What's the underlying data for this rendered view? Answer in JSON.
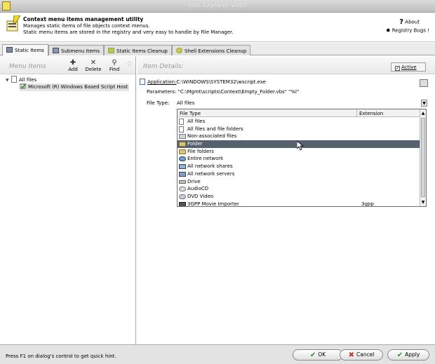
{
  "window": {
    "title": "Fast Explorer 2007"
  },
  "header": {
    "title": "Context menu items management utility",
    "line1": "Manages static items of file objects context menus.",
    "line2": "Static menu items are stored in the registry and very easy to handle by File Manager.",
    "about_label": "About",
    "registry_bugs_label": "Registry Bugs !"
  },
  "tabs": [
    {
      "label": "Static Items",
      "icon": "static-items-icon",
      "active": true
    },
    {
      "label": "Submenu Items",
      "icon": "submenu-icon",
      "active": false
    },
    {
      "label": "Static Items Cleanup",
      "icon": "cleanup-icon",
      "active": false
    },
    {
      "label": "Shell Extensions Cleanup",
      "icon": "shell-ext-icon",
      "active": false
    }
  ],
  "menu_items": {
    "title": "Menu Items",
    "toolbar": {
      "add_label": "Add",
      "delete_label": "Delete",
      "find_label": "Find"
    },
    "tree": {
      "root_label": "All files",
      "child_label": "Microsoft (R) Windows Based Script Host"
    }
  },
  "item_details": {
    "title": "Item Details:",
    "active_label": "Active",
    "active_checked": true,
    "application_label": "Application:",
    "application_value": "C:\\WINDOWS\\SYSTEM32\\wscript.exe",
    "parameters_label": "Parameters:",
    "parameters_value": "\"C:\\Mgmt\\scripts\\Context\\Empty_Folder.vbs\" \"%l\"",
    "file_type_label": "File Type:",
    "file_type_value": "All files"
  },
  "file_type_list": {
    "columns": {
      "file_type": "File Type",
      "extension": "Extension"
    },
    "rows": [
      {
        "name": "All files",
        "ext": "",
        "icon": "blank-file-icon"
      },
      {
        "name": "All files and file folders",
        "ext": "",
        "icon": "blank-file-icon"
      },
      {
        "name": "Non-associated files",
        "ext": "",
        "icon": "unknown-file-icon"
      },
      {
        "name": "Folder",
        "ext": "",
        "icon": "folder-icon",
        "selected": true
      },
      {
        "name": "File folders",
        "ext": "",
        "icon": "folder-icon"
      },
      {
        "name": "Entire network",
        "ext": "",
        "icon": "network-icon"
      },
      {
        "name": "All network shares",
        "ext": "",
        "icon": "network-share-icon"
      },
      {
        "name": "All network servers",
        "ext": "",
        "icon": "network-server-icon"
      },
      {
        "name": "Drive",
        "ext": "",
        "icon": "drive-icon"
      },
      {
        "name": "AudioCD",
        "ext": "",
        "icon": "cd-icon"
      },
      {
        "name": "DVD Video",
        "ext": "",
        "icon": "dvd-icon"
      },
      {
        "name": "3GPP Movie Importer",
        "ext": "3gpp",
        "icon": "movie-icon"
      }
    ]
  },
  "status": {
    "hint": "Press F1 on dialog's control to get quick hint.",
    "ok_label": "OK",
    "cancel_label": "Cancel",
    "apply_label": "Apply"
  },
  "colors": {
    "selection": "#566170",
    "ok_green": "#2e8b2e",
    "cancel_red": "#c0392b"
  }
}
